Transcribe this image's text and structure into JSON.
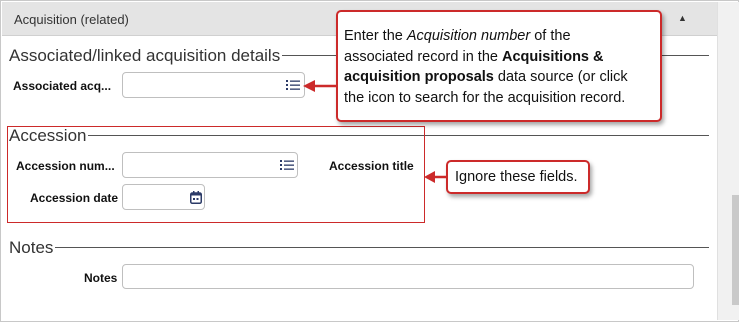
{
  "section": {
    "title": "Acquisition (related)"
  },
  "associated_group": {
    "title": "Associated/linked acquisition details",
    "field_label": "Associated acq...",
    "field_value": ""
  },
  "accession_group": {
    "title": "Accession",
    "number_label": "Accession num...",
    "number_value": "",
    "title_label": "Accession title",
    "date_label": "Accession date",
    "date_value": ""
  },
  "notes_group": {
    "title": "Notes",
    "notes_label": "Notes",
    "notes_value": ""
  },
  "callout_main": {
    "t1": "Enter the ",
    "t2": "Acquisition number",
    "t3": " of the",
    "t4": "associated record in the ",
    "t5": "Acquisitions &",
    "t6": "acquisition proposals",
    "t7": " data source (or click",
    "t8": "the icon to search for the acquisition record."
  },
  "callout_ignore": {
    "text": "Ignore these fields."
  },
  "colors": {
    "annotation_red": "#cc2a2a",
    "header_gray": "#e4e4e4",
    "icon_navy": "#2b3a67"
  },
  "icons": {
    "lookup": "list-lookup-icon",
    "calendar": "calendar-icon",
    "collapse": "triangle-up-icon"
  }
}
